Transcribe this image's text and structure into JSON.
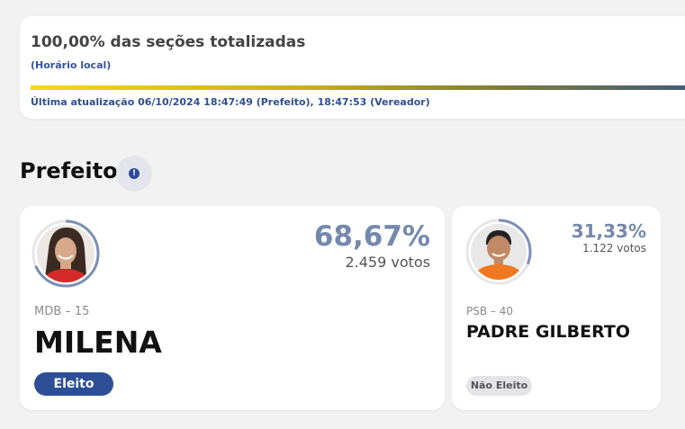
{
  "status": {
    "title": "100,00% das seções totalizadas",
    "subtitle": "(Horário local)",
    "progress_percent": 100,
    "last_update": "Última atualização 06/10/2024 18:47:49 (Prefeito), 18:47:53 (Vereador)"
  },
  "section": {
    "title": "Prefeito",
    "info_icon": "!"
  },
  "candidates": [
    {
      "percent": "68,67%",
      "votes": "2.459 votos",
      "party": "MDB – 15",
      "name": "MILENA",
      "status": "Eleito",
      "share": 0.6867
    },
    {
      "percent": "31,33%",
      "votes": "1.122 votos",
      "party": "PSB – 40",
      "name": "PADRE GILBERTO",
      "status": "Não Eleito",
      "share": 0.3133
    }
  ],
  "colors": {
    "accent": "#2e4f98",
    "percent_text": "#7588ad",
    "ring": "#7c8fb5"
  }
}
